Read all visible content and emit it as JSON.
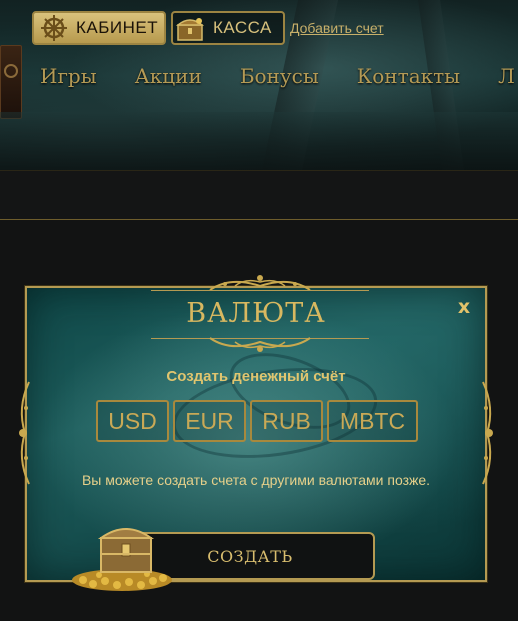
{
  "header": {
    "cabinet_label": "КАБИНЕТ",
    "kassa_label": "КАССА",
    "add_account_link": "Добавить счет",
    "nav": [
      "Игры",
      "Акции",
      "Бонусы",
      "Контакты",
      "Л"
    ]
  },
  "modal": {
    "title": "ВАЛЮТА",
    "close_label": "x",
    "subtitle": "Создать денежный счёт",
    "currencies": [
      "USD",
      "EUR",
      "RUB",
      "MBTC"
    ],
    "note": "Вы можете создать счета с другими валютами позже.",
    "create_button": "СОЗДАТЬ"
  },
  "icons": {
    "cabinet": "ship-wheel-icon",
    "kassa": "treasure-chest-icon",
    "close": "close-icon",
    "decor": "treasure-chest-gold-icon"
  },
  "colors": {
    "gold": "#b49a52",
    "teal": "#1d5d5c",
    "dark": "#121313"
  }
}
